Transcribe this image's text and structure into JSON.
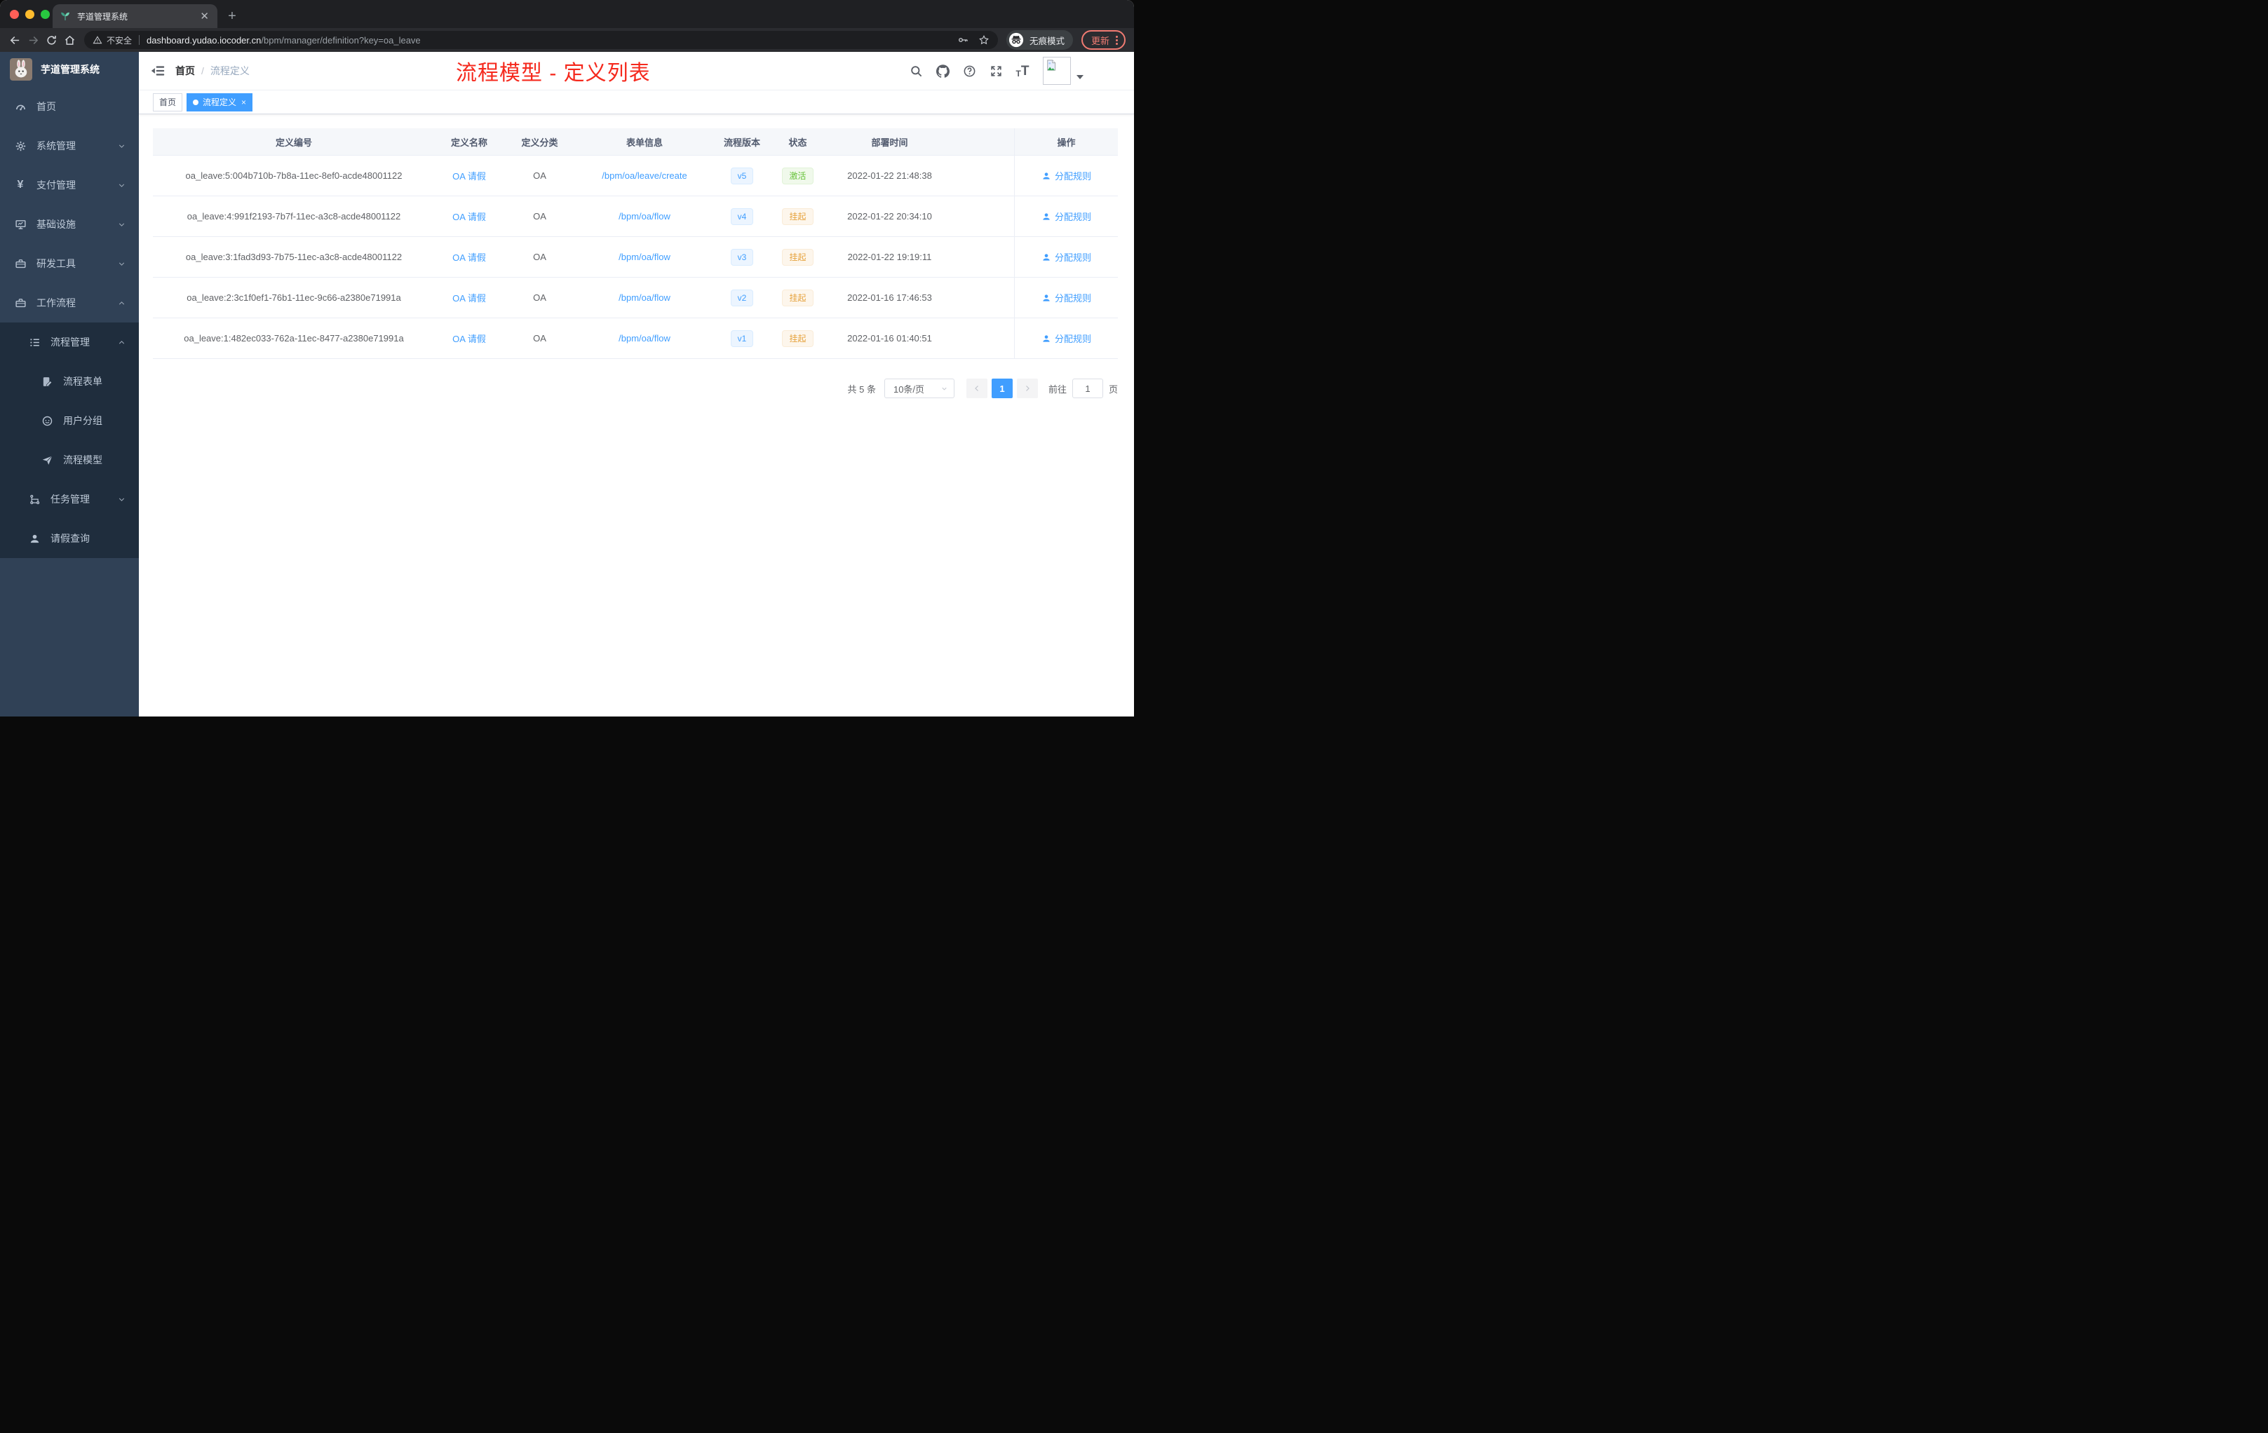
{
  "window": {
    "controls": [
      "close",
      "minimize",
      "zoom"
    ]
  },
  "browser": {
    "tab_title": "芋道管理系统",
    "new_tab_label": "+",
    "toolbar_icons": [
      "back-arrow-icon",
      "forward-arrow-icon",
      "reload-icon",
      "home-icon"
    ],
    "url_security": "不安全",
    "url_domain": "dashboard.yudao.iocoder.cn",
    "url_path": "/bpm/manager/definition?key=oa_leave",
    "url_trailing_icons": [
      "key-icon",
      "star-icon"
    ],
    "incognito_label": "无痕模式",
    "update_label": "更新"
  },
  "sidebar": {
    "title": "芋道管理系统",
    "menu": [
      {
        "key": "home",
        "label": "首页",
        "icon": "dashboard-icon",
        "level": 1
      },
      {
        "key": "system",
        "label": "系统管理",
        "icon": "gear-icon",
        "level": 1,
        "chevron": "down"
      },
      {
        "key": "payment",
        "label": "支付管理",
        "icon": "yen-icon",
        "level": 1,
        "chevron": "down"
      },
      {
        "key": "infrastructure",
        "label": "基础设施",
        "icon": "monitor-icon",
        "level": 1,
        "chevron": "down"
      },
      {
        "key": "dev-tools",
        "label": "研发工具",
        "icon": "toolbox-icon",
        "level": 1,
        "chevron": "down"
      },
      {
        "key": "workflow",
        "label": "工作流程",
        "icon": "briefcase-icon",
        "level": 1,
        "chevron": "up"
      },
      {
        "key": "process-mgmt",
        "label": "流程管理",
        "icon": "list-icon",
        "level": 2,
        "chevron": "up",
        "dark": true
      },
      {
        "key": "process-form",
        "label": "流程表单",
        "icon": "form-icon",
        "level": 3,
        "dark": true
      },
      {
        "key": "user-group",
        "label": "用户分组",
        "icon": "group-icon",
        "level": 3,
        "dark": true
      },
      {
        "key": "process-model",
        "label": "流程模型",
        "icon": "send-icon",
        "level": 3,
        "dark": true
      },
      {
        "key": "task-mgmt",
        "label": "任务管理",
        "icon": "tree-icon",
        "level": 2,
        "chevron": "down",
        "dark": true
      },
      {
        "key": "leave-query",
        "label": "请假查询",
        "icon": "user-icon",
        "level": 2,
        "dark": true
      }
    ]
  },
  "header": {
    "breadcrumb": {
      "home": "首页",
      "separator": "/",
      "current": "流程定义"
    },
    "annotation": "流程模型 - 定义列表",
    "annotation_color": "#f5291d",
    "icons": [
      "search-icon",
      "github-icon",
      "question-icon",
      "fullscreen-icon",
      "font-size-icon"
    ],
    "avatar_icon": "broken-image-icon"
  },
  "tags_view": [
    {
      "label": "首页",
      "active": false,
      "closable": false
    },
    {
      "label": "流程定义",
      "active": true,
      "closable": true
    }
  ],
  "table": {
    "columns": [
      "定义编号",
      "定义名称",
      "定义分类",
      "表单信息",
      "流程版本",
      "状态",
      "部署时间",
      "操作"
    ],
    "action_label": "分配规则",
    "rows": [
      {
        "id": "oa_leave:5:004b710b-7b8a-11ec-8ef0-acde48001122",
        "name": "OA 请假",
        "category": "OA",
        "form": "/bpm/oa/leave/create",
        "version": "v5",
        "status": "激活",
        "status_type": "success",
        "deployed_at": "2022-01-22 21:48:38"
      },
      {
        "id": "oa_leave:4:991f2193-7b7f-11ec-a3c8-acde48001122",
        "name": "OA 请假",
        "category": "OA",
        "form": "/bpm/oa/flow",
        "version": "v4",
        "status": "挂起",
        "status_type": "warning",
        "deployed_at": "2022-01-22 20:34:10"
      },
      {
        "id": "oa_leave:3:1fad3d93-7b75-11ec-a3c8-acde48001122",
        "name": "OA 请假",
        "category": "OA",
        "form": "/bpm/oa/flow",
        "version": "v3",
        "status": "挂起",
        "status_type": "warning",
        "deployed_at": "2022-01-22 19:19:11"
      },
      {
        "id": "oa_leave:2:3c1f0ef1-76b1-11ec-9c66-a2380e71991a",
        "name": "OA 请假",
        "category": "OA",
        "form": "/bpm/oa/flow",
        "version": "v2",
        "status": "挂起",
        "status_type": "warning",
        "deployed_at": "2022-01-16 17:46:53"
      },
      {
        "id": "oa_leave:1:482ec033-762a-11ec-8477-a2380e71991a",
        "name": "OA 请假",
        "category": "OA",
        "form": "/bpm/oa/flow",
        "version": "v1",
        "status": "挂起",
        "status_type": "warning",
        "deployed_at": "2022-01-16 01:40:51"
      }
    ]
  },
  "pagination": {
    "total": "共 5 条",
    "page_size": "10条/页",
    "current_page": "1",
    "goto_label": "前往",
    "goto_value": "1",
    "unit_label": "页"
  },
  "colors": {
    "accent": "#409eff",
    "success": "#67c23a",
    "warning": "#e6a23c",
    "sidebar_bg": "#304156",
    "submenu_bg": "#1f2d3d",
    "annotation_red": "#f5291d"
  }
}
